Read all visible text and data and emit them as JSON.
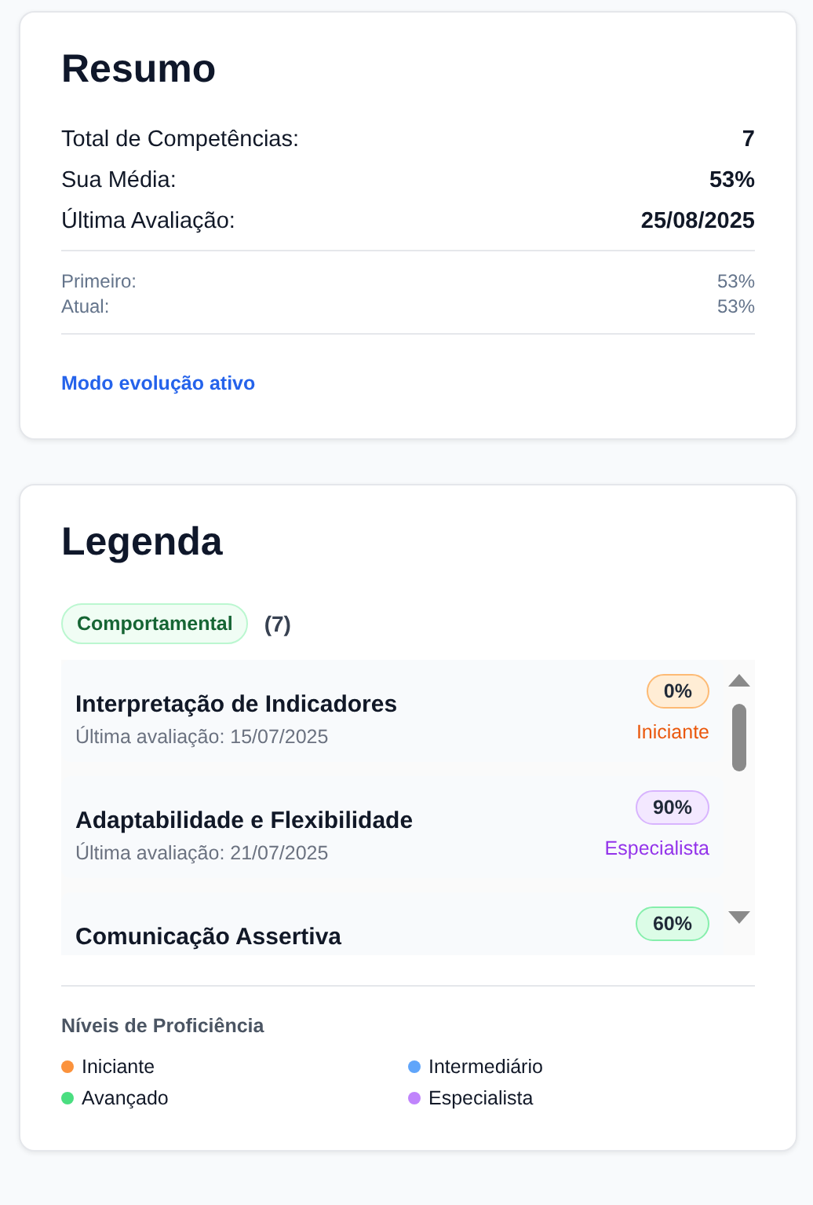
{
  "summary": {
    "title": "Resumo",
    "stats": [
      {
        "label": "Total de Competências:",
        "value": "7"
      },
      {
        "label": "Sua Média:",
        "value": "53%"
      },
      {
        "label": "Última Avaliação:",
        "value": "25/08/2025"
      }
    ],
    "evolution": [
      {
        "label": "Primeiro:",
        "value": "53%"
      },
      {
        "label": "Atual:",
        "value": "53%"
      }
    ],
    "mode_link": "Modo evolução ativo"
  },
  "legend": {
    "title": "Legenda",
    "category": {
      "label": "Comportamental",
      "count": "(7)"
    },
    "items": [
      {
        "name": "Interpretação de Indicadores",
        "date": "Última avaliação: 15/07/2025",
        "percent": "0%",
        "kind": "iniciante",
        "level_label": "Iniciante"
      },
      {
        "name": "Adaptabilidade e Flexibilidade",
        "date": "Última avaliação: 21/07/2025",
        "percent": "90%",
        "kind": "especialista",
        "level_label": "Especialista"
      },
      {
        "name": "Comunicação Assertiva",
        "percent": "60%",
        "kind": "avancado"
      }
    ],
    "levels_title": "Níveis de Proficiência",
    "levels": [
      {
        "label": "Iniciante",
        "color": "#fb923c"
      },
      {
        "label": "Intermediário",
        "color": "#60a5fa"
      },
      {
        "label": "Avançado",
        "color": "#4ade80"
      },
      {
        "label": "Especialista",
        "color": "#c084fc"
      }
    ]
  }
}
